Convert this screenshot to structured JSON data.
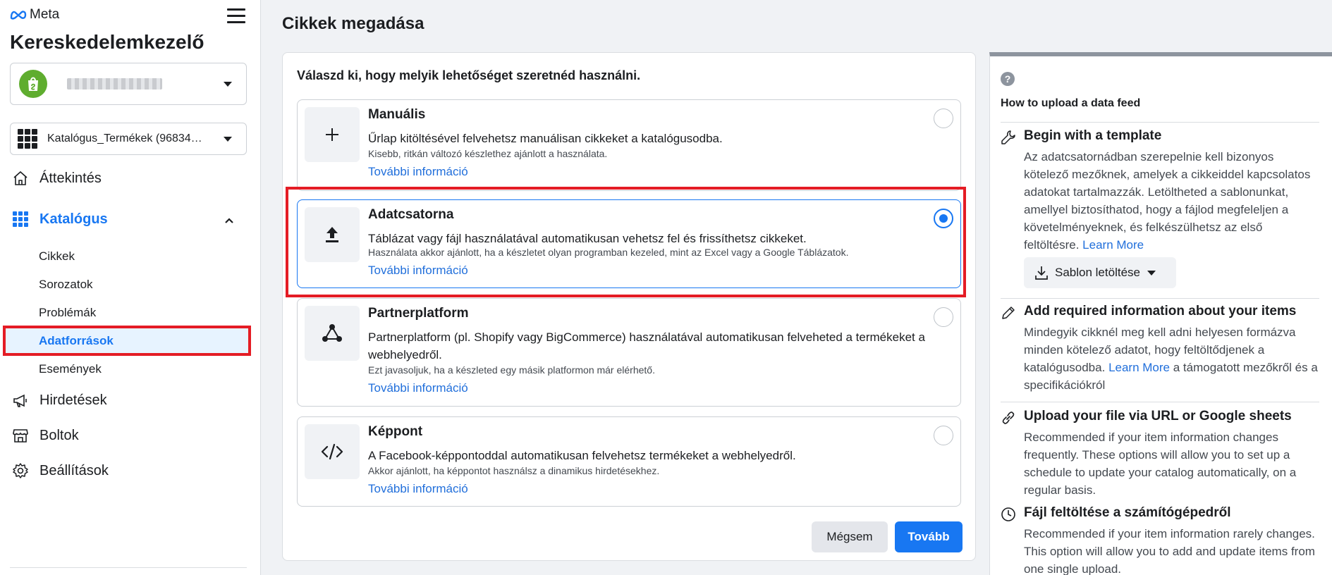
{
  "sidebar": {
    "brand": "Meta",
    "app_title": "Kereskedelemkezelő",
    "catalog_selector": "Katalógus_Termékek (96834…",
    "nav": [
      {
        "label": "Áttekintés",
        "icon": "home-icon"
      },
      {
        "label": "Katalógus",
        "icon": "grid-icon"
      },
      {
        "label": "Hirdetések",
        "icon": "megaphone-icon"
      },
      {
        "label": "Boltok",
        "icon": "store-icon"
      },
      {
        "label": "Beállítások",
        "icon": "gear-icon"
      }
    ],
    "sub_items": [
      "Cikkek",
      "Sorozatok",
      "Problémák",
      "Adatforrások",
      "Események"
    ]
  },
  "main": {
    "page_title": "Cikkek megadása",
    "heading": "Válaszd ki, hogy melyik lehetőséget szeretnéd használni.",
    "options": [
      {
        "title": "Manuális",
        "desc": "Űrlap kitöltésével felvehetsz manuálisan cikkeket a katalógusodba.",
        "sub": "Kisebb, ritkán változó készlethez ajánlott a használata.",
        "link": "További információ",
        "icon": "plus-icon"
      },
      {
        "title": "Adatcsatorna",
        "desc": "Táblázat vagy fájl használatával automatikusan vehetsz fel és frissíthetsz cikkeket.",
        "sub": "Használata akkor ajánlott, ha a készletet olyan programban kezeled, mint az Excel vagy a Google Táblázatok.",
        "link": "További információ",
        "icon": "upload-icon"
      },
      {
        "title": "Partnerplatform",
        "desc": "Partnerplatform (pl. Shopify vagy BigCommerce) használatával automatikusan felveheted a termékeket a webhelyedről.",
        "sub": "Ezt javasoljuk, ha a készleted egy másik platformon már elérhető.",
        "link": "További információ",
        "icon": "network-icon"
      },
      {
        "title": "Képpont",
        "desc": "A Facebook-képpontoddal automatikusan felvehetsz termékeket a webhelyedről.",
        "sub": "Akkor ajánlott, ha képpontot használsz a dinamikus hirdetésekhez.",
        "link": "További információ",
        "icon": "code-icon"
      }
    ],
    "selected_option": "Adatcsatorna",
    "cancel_label": "Mégsem",
    "next_label": "Tovább"
  },
  "help": {
    "title": "How to upload a data feed",
    "sections": [
      {
        "title": "Begin with a template",
        "body": "Az adatcsatornádban szerepelnie kell bizonyos kötelező mezőknek, amelyek a cikkeiddel kapcsolatos adatokat tartalmazzák. Letöltheted a sablonunkat, amellyel biztosíthatod, hogy a fájlod megfeleljen a követelményeknek, és felkészülhetsz az első feltöltésre.",
        "link": "Learn More",
        "button": "Sablon letöltése"
      },
      {
        "title": "Add required information about your items",
        "body_before": "Mindegyik cikknél meg kell adni helyesen formázva minden kötelező adatot, hogy feltöltődjenek a katalógusodba.",
        "link": "Learn More",
        "body_after": "a támogatott mezőkről és a specifikációkról"
      },
      {
        "title": "Upload your file via URL or Google sheets",
        "body": "Recommended if your item information changes frequently. These options will allow you to set up a schedule to update your catalog automatically, on a regular basis."
      },
      {
        "title": "Fájl feltöltése a számítógépedről",
        "body": "Recommended if your item information rarely changes. This option will allow you to add and update items from one single upload."
      }
    ]
  },
  "colors": {
    "accent": "#1877f2",
    "link": "#216fdb",
    "highlight": "#e41c25",
    "account_avatar": "#5fad2f"
  }
}
